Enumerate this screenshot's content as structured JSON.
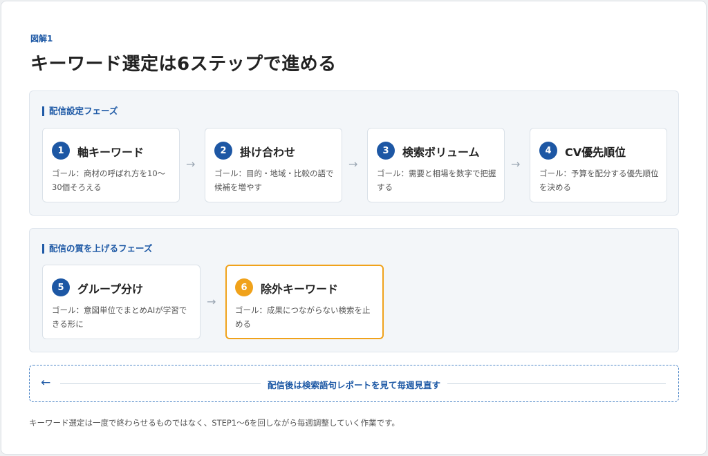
{
  "figure_label": "図解1",
  "title": "キーワード選定は6ステップで進める",
  "phases": [
    {
      "label": "配信設定フェーズ",
      "steps": [
        {
          "num": "1",
          "title": "軸キーワード",
          "desc": "ゴール：商材の呼ばれ方を10〜30個そろえる"
        },
        {
          "num": "2",
          "title": "掛け合わせ",
          "desc": "ゴール：目的・地域・比較の語で候補を増やす"
        },
        {
          "num": "3",
          "title": "検索ボリューム",
          "desc": "ゴール：需要と相場を数字で把握する"
        },
        {
          "num": "4",
          "title": "CV優先順位",
          "desc": "ゴール：予算を配分する優先順位を決める"
        }
      ]
    },
    {
      "label": "配信の質を上げるフェーズ",
      "steps": [
        {
          "num": "5",
          "title": "グループ分け",
          "desc": "ゴール：意図単位でまとめAIが学習できる形に"
        },
        {
          "num": "6",
          "title": "除外キーワード",
          "desc": "ゴール：成果につながらない検索を止める",
          "highlight": true
        }
      ]
    }
  ],
  "arrow_glyph": "→",
  "loop": {
    "arrow": "←",
    "text": "配信後は検索語句レポートを見て毎週見直す"
  },
  "footnote": "キーワード選定は一度で終わらせるものではなく、STEP1〜6を回しながら毎週調整していく作業です。",
  "colors": {
    "accent": "#1d57a4",
    "highlight": "#f0a21b",
    "phase_bg": "#f3f6f9"
  }
}
